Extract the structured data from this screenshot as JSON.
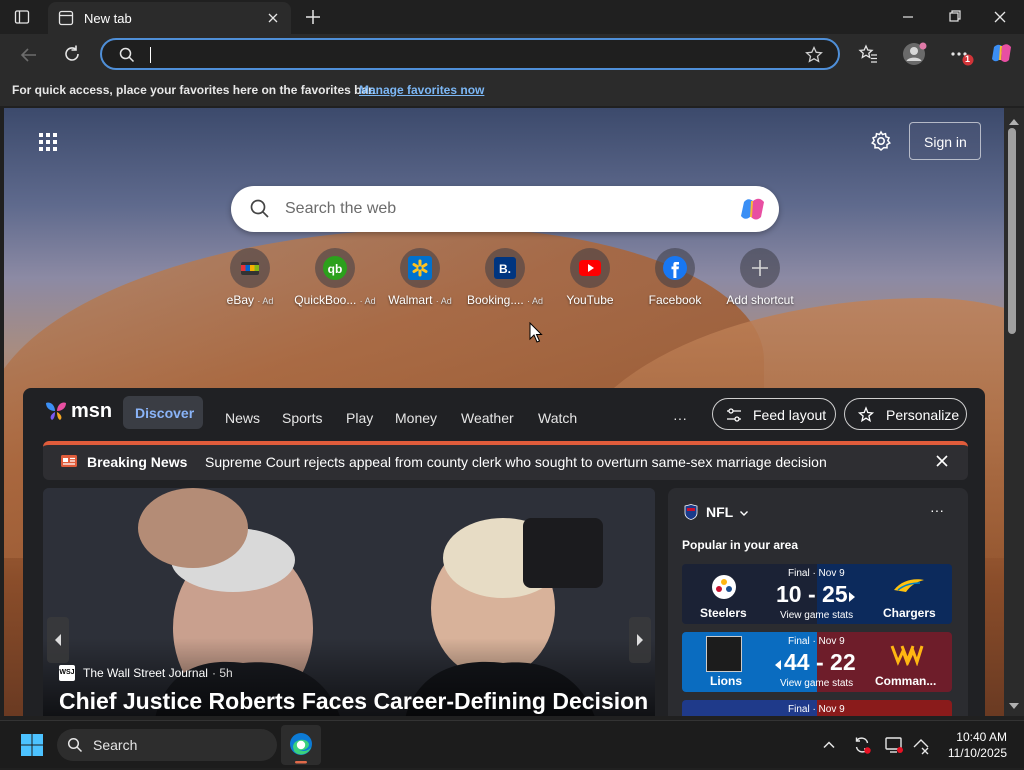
{
  "browser": {
    "tab_title": "New tab",
    "address_value": "",
    "favorites_message": "For quick access, place your favorites here on the favorites bar.",
    "favorites_link": "Manage favorites now",
    "notification_badge": "1"
  },
  "newtab": {
    "search_placeholder": "Search the web",
    "sign_in": "Sign in",
    "shortcuts": [
      {
        "label": "eBay",
        "ad": "· Ad",
        "icon": "ebay-icon"
      },
      {
        "label": "QuickBoo...",
        "ad": "· Ad",
        "icon": "quickbooks-icon"
      },
      {
        "label": "Walmart",
        "ad": "· Ad",
        "icon": "walmart-icon"
      },
      {
        "label": "Booking....",
        "ad": "· Ad",
        "icon": "booking-icon"
      },
      {
        "label": "YouTube",
        "ad": "",
        "icon": "youtube-icon"
      },
      {
        "label": "Facebook",
        "ad": "",
        "icon": "facebook-icon"
      },
      {
        "label": "Add shortcut",
        "ad": "",
        "icon": "plus-icon"
      }
    ]
  },
  "msn": {
    "brand": "msn",
    "tabs": [
      "Discover",
      "News",
      "Sports",
      "Play",
      "Money",
      "Weather",
      "Watch"
    ],
    "more": "···",
    "feed_layout": "Feed layout",
    "personalize": "Personalize",
    "breaking": {
      "label": "Breaking News",
      "text": "Supreme Court rejects appeal from county clerk who sought to overturn same-sex marriage decision"
    },
    "story": {
      "source": "The Wall Street Journal",
      "age": "· 5h",
      "headline": "Chief Justice Roberts Faces Career-Defining Decision"
    },
    "nfl": {
      "title": "NFL",
      "subtitle": "Popular in your area",
      "more": "···",
      "games": [
        {
          "status": "Final · Nov 9",
          "home": "Steelers",
          "away": "Chargers",
          "score": "10 - 25",
          "link": "View game stats",
          "color_left": "#1b2235",
          "color_right": "#0c2a5c"
        },
        {
          "status": "Final · Nov 9",
          "home": "Lions",
          "away": "Comman...",
          "score": "44 - 22",
          "link": "View game stats",
          "color_left": "#0a6cc0",
          "color_right": "#6e1d2a"
        },
        {
          "status": "Final · Nov 9",
          "home": "",
          "away": "",
          "score": "",
          "link": "",
          "color_left": "#1f3a8a",
          "color_right": "#8a1b1b"
        }
      ]
    }
  },
  "taskbar": {
    "search": "Search",
    "time": "10:40 AM",
    "date": "11/10/2025"
  },
  "colors": {
    "accent": "#4f8fd8",
    "breaking_bar": "#e05c3b",
    "link": "#7cb7f5"
  }
}
